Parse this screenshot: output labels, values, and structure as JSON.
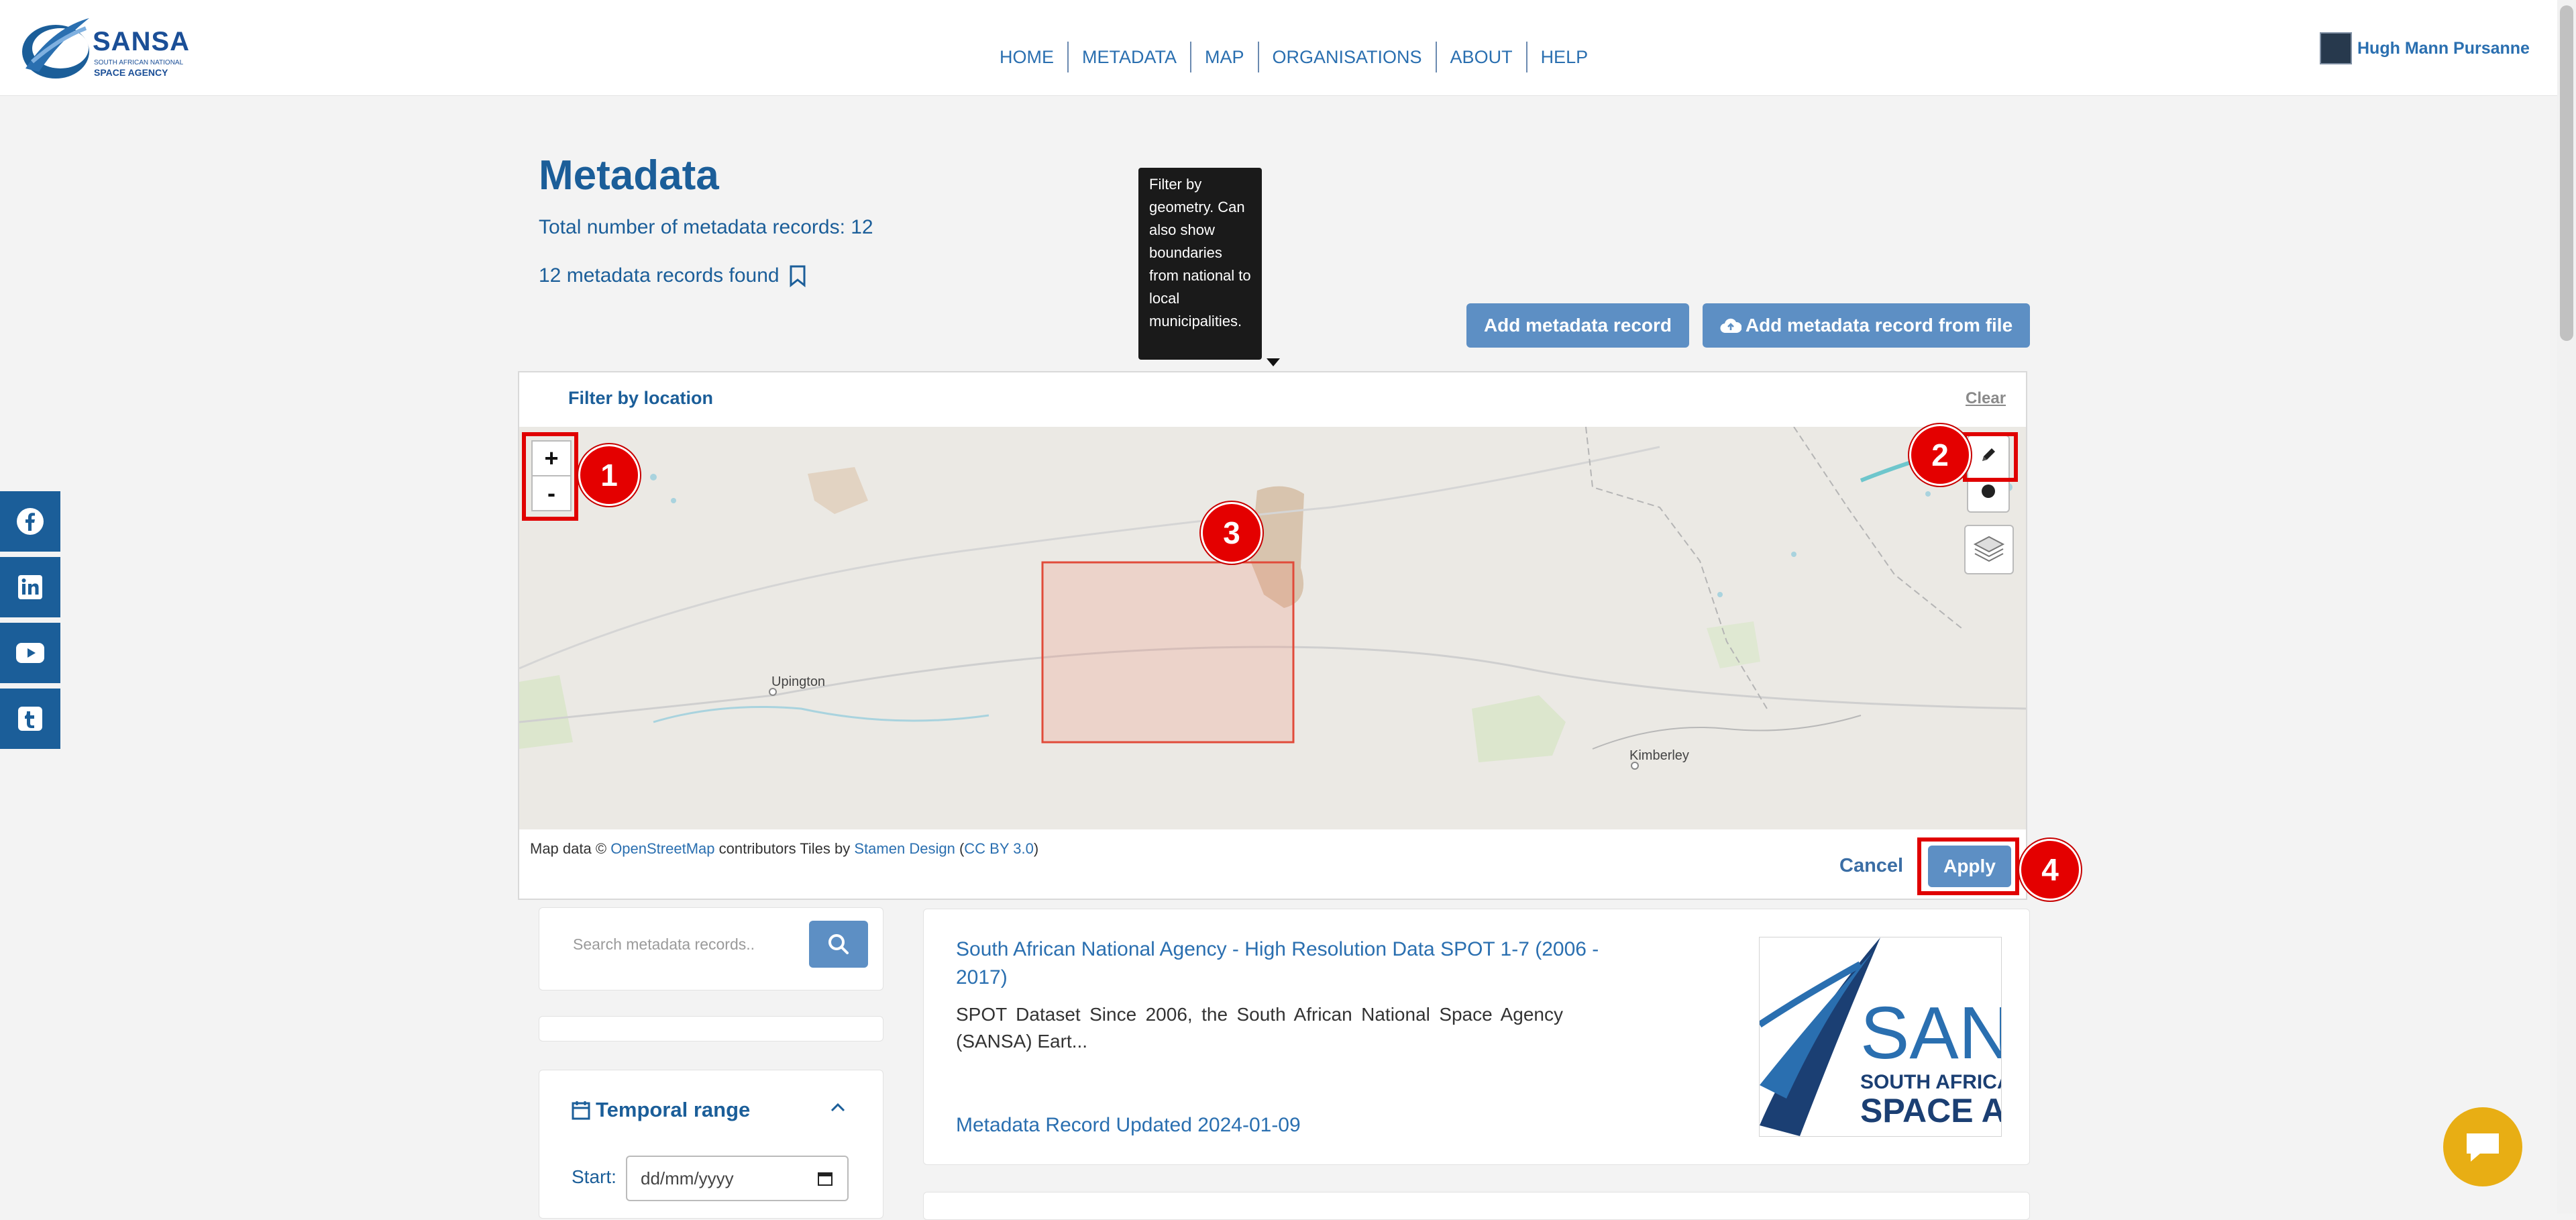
{
  "brand": {
    "name": "SANSA",
    "sub1": "SOUTH AFRICAN NATIONAL",
    "sub2": "SPACE AGENCY"
  },
  "nav": [
    "HOME",
    "METADATA",
    "MAP",
    "ORGANISATIONS",
    "ABOUT",
    "HELP"
  ],
  "user": {
    "name": "Hugh Mann Pursanne"
  },
  "social": [
    "facebook-icon",
    "linkedin-icon",
    "youtube-icon",
    "tumblr-icon"
  ],
  "page": {
    "title": "Metadata",
    "total": "Total number of metadata records: 12",
    "found": "12 metadata records found"
  },
  "tooltip": "Filter by geometry. Can also show boundaries from national to local municipalities.",
  "buttons": {
    "add": "Add metadata record",
    "add_file": "Add metadata record from file",
    "apply": "Apply",
    "cancel": "Cancel"
  },
  "filter": {
    "title": "Filter by location",
    "clear": "Clear"
  },
  "map": {
    "zoom_in": "+",
    "zoom_out": "-",
    "places": [
      "Upington",
      "Kimberley"
    ],
    "attribution": {
      "prefix": "Map data ©",
      "osm": "OpenStreetMap",
      "contributors": "contributors   Tiles by",
      "stamen": "Stamen Design",
      "open": "(",
      "cc": "CC BY 3.0",
      "close": ")"
    }
  },
  "badges": [
    "1",
    "2",
    "3",
    "4"
  ],
  "search": {
    "placeholder": "Search metadata records.."
  },
  "temporal": {
    "title": "Temporal range",
    "start_label": "Start:",
    "start_placeholder": "dd/mm/yyyy"
  },
  "result": {
    "title": "South African National Agency - High Resolution Data SPOT 1-7 (2006 - 2017)",
    "description": "SPOT Dataset Since 2006, the South African National Space Agency (SANSA) Eart...",
    "updated": "Metadata Record Updated 2024-01-09",
    "thumb_text1": "SAN",
    "thumb_text2": "SOUTH AFRICA",
    "thumb_text3": "SPACE A"
  },
  "colors": {
    "primary": "#1b5e99",
    "button": "#5d8fc4",
    "highlight": "#e00000",
    "selection_fill": "#f5c6c0"
  }
}
